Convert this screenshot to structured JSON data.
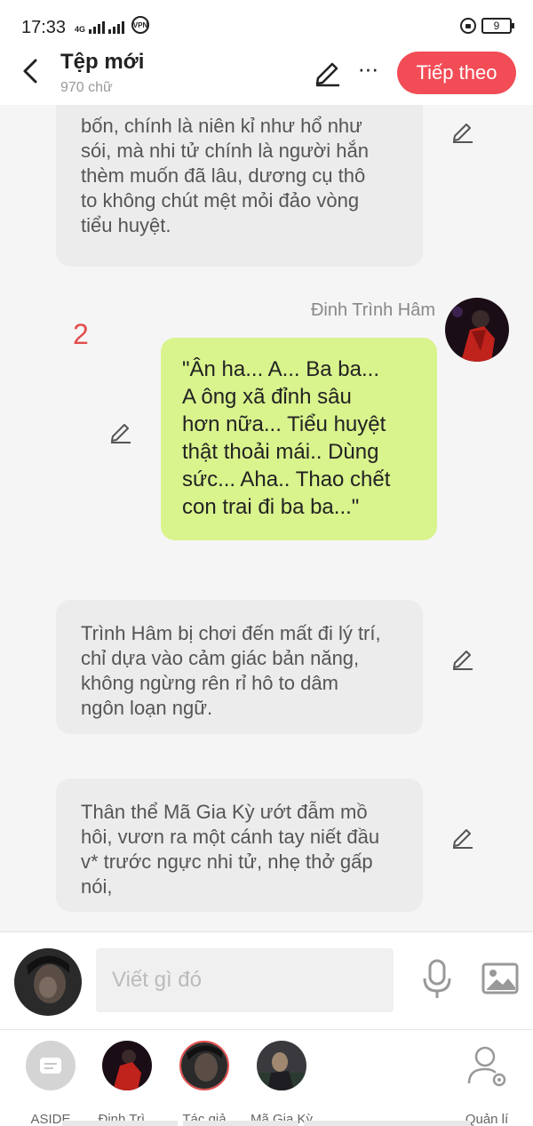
{
  "status": {
    "time": "17:33",
    "net": "4G",
    "vpn": "VPN",
    "battery": "9"
  },
  "header": {
    "title": "Tệp mới",
    "word_count": "970 chữ",
    "next_label": "Tiếp theo"
  },
  "messages": [
    {
      "type": "narration",
      "lines": [
        "bốn, chính là niên kỉ như hổ như",
        "sói, mà nhi tử chính là người hắn",
        "thèm muốn đã lâu, dương cụ thô",
        "to không chút mệt mỏi đảo vòng",
        "tiểu huyệt."
      ]
    },
    {
      "type": "character",
      "sender": "Đinh Trình Hâm",
      "number": "2",
      "lines": [
        "\"Ân ha... A... Ba ba...",
        "A ông xã đỉnh sâu",
        "hơn nữa... Tiểu huyệt",
        "thật thoải mái.. Dùng",
        "sức... Aha.. Thao chết",
        "con trai đi ba ba...\""
      ]
    },
    {
      "type": "narration",
      "lines": [
        "Trình Hâm bị chơi đến mất đi lý trí,",
        "chỉ dựa vào cảm giác bản năng,",
        "không ngừng rên rỉ hô to dâm",
        "ngôn loạn ngữ."
      ]
    },
    {
      "type": "narration",
      "lines": [
        "Thân thể Mã Gia Kỳ ướt đẫm mồ",
        "hôi, vươn ra một cánh tay niết đầu",
        "v* trước ngực nhi tử, nhẹ thở gấp",
        "nói,"
      ]
    }
  ],
  "composer": {
    "placeholder": "Viết gì đó"
  },
  "characters": [
    {
      "label": "ASIDE"
    },
    {
      "label": "Đinh Trì..."
    },
    {
      "label": "Tác giả"
    },
    {
      "label": "Mã Gia Kỳ"
    },
    {
      "label": "Quản lí"
    }
  ],
  "colors": {
    "accent": "#f24c56",
    "bubble_green": "#d9f38d",
    "bubble_gray": "#ececec",
    "number_red": "#e34d4d"
  }
}
